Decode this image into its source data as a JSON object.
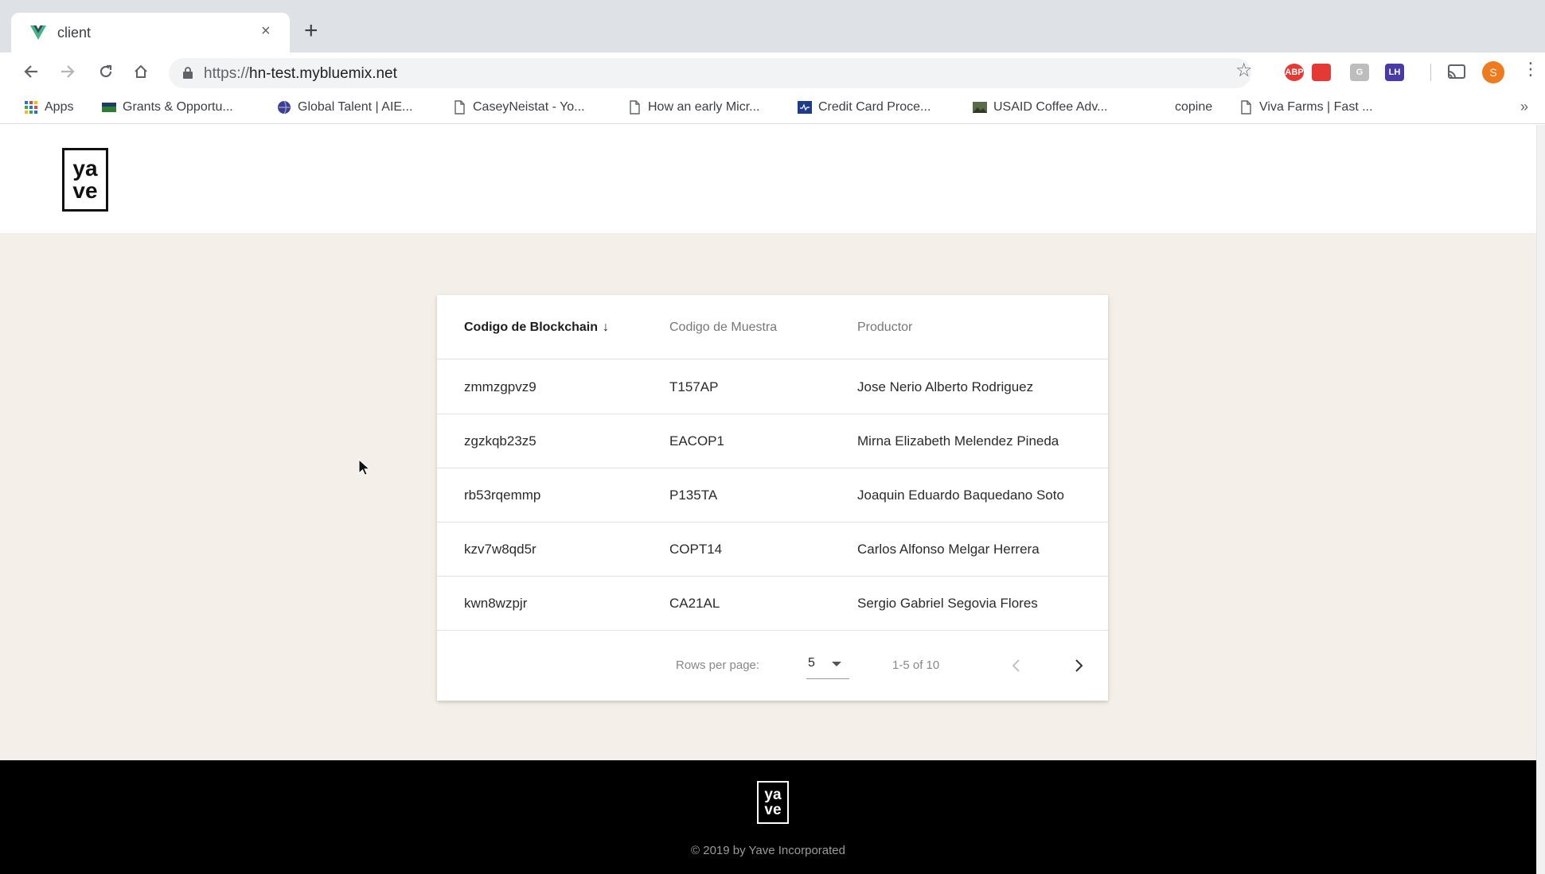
{
  "browser": {
    "tab_title": "client",
    "tab_close_glyph": "×",
    "new_tab_glyph": "+",
    "url_scheme": "https://",
    "url_host": "hn-test.mybluemix.net",
    "avatar_letter": "S",
    "extensions": [
      {
        "icon": "abp-extension-icon",
        "label": "ABP",
        "color": "#e53935"
      },
      {
        "icon": "red-extension-icon",
        "label": "",
        "color": "#e53935"
      },
      {
        "icon": "grey-extension-icon",
        "label": "G",
        "color": "#bdbdbd"
      },
      {
        "icon": "purple-extension-icon",
        "label": "",
        "color": "#5c2d91"
      },
      {
        "icon": "lh-extension-icon",
        "label": "LH",
        "color": "#4a3aa8"
      }
    ],
    "bookmarks": [
      {
        "label": "Apps",
        "icon": "apps-grid-icon"
      },
      {
        "label": "Grants & Opportu...",
        "icon": "usda-icon"
      },
      {
        "label": "Global Talent | AIE...",
        "icon": "globe-icon"
      },
      {
        "label": "CaseyNeistat - Yo...",
        "icon": "page-icon"
      },
      {
        "label": "How an early Micr...",
        "icon": "page-icon"
      },
      {
        "label": "Credit Card Proce...",
        "icon": "card-icon"
      },
      {
        "label": "USAID Coffee Adv...",
        "icon": "photo-icon"
      },
      {
        "label": "copine",
        "icon": ""
      },
      {
        "label": "Viva Farms | Fast ...",
        "icon": "page-icon"
      }
    ],
    "bookmarks_more": "»"
  },
  "header": {
    "logo_top": "ya",
    "logo_bottom": "ve"
  },
  "table": {
    "columns": [
      {
        "label": "Codigo de Blockchain",
        "sorted": true
      },
      {
        "label": "Codigo de Muestra",
        "sorted": false
      },
      {
        "label": "Productor",
        "sorted": false
      }
    ],
    "sort_arrow": "↓",
    "rows": [
      {
        "blockchain": "zmmzgpvz9",
        "muestra": "T157AP",
        "productor": "Jose Nerio Alberto Rodriguez"
      },
      {
        "blockchain": "zgzkqb23z5",
        "muestra": "EACOP1",
        "productor": "Mirna Elizabeth Melendez Pineda"
      },
      {
        "blockchain": "rb53rqemmp",
        "muestra": "P135TA",
        "productor": "Joaquin Eduardo Baquedano Soto"
      },
      {
        "blockchain": "kzv7w8qd5r",
        "muestra": "COPT14",
        "productor": "Carlos Alfonso Melgar Herrera"
      },
      {
        "blockchain": "kwn8wzpjr",
        "muestra": "CA21AL",
        "productor": "Sergio Gabriel Segovia Flores"
      }
    ],
    "pagination": {
      "rows_per_page_label": "Rows per page:",
      "rows_per_page_value": "5",
      "range": "1-5 of 10"
    }
  },
  "footer": {
    "logo_top": "ya",
    "logo_bottom": "ve",
    "copyright": "© 2019 by Yave Incorporated"
  }
}
